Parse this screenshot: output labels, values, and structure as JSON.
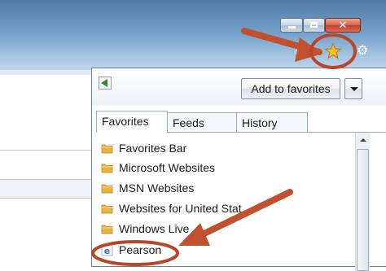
{
  "window": {
    "controls": {
      "minimize": "minimize",
      "maximize": "maximize",
      "close": "close"
    }
  },
  "toolbar": {
    "icons": [
      "home-icon",
      "favorites-star-icon",
      "tools-gear-icon"
    ]
  },
  "favorites_center": {
    "add_button_label": "Add to favorites",
    "tabs": [
      {
        "label": "Favorites",
        "selected": true
      },
      {
        "label": "Feeds",
        "selected": false
      },
      {
        "label": "History",
        "selected": false
      }
    ],
    "items": [
      {
        "label": "Favorites Bar",
        "icon": "folder-icon"
      },
      {
        "label": "Microsoft Websites",
        "icon": "folder-icon"
      },
      {
        "label": "MSN Websites",
        "icon": "folder-icon"
      },
      {
        "label": "Websites for United Stat",
        "icon": "folder-icon"
      },
      {
        "label": "Windows Live",
        "icon": "folder-icon"
      },
      {
        "label": "Pearson",
        "icon": "ie-page-icon"
      }
    ]
  },
  "annotations": {
    "color": "#c0502e",
    "targets": [
      "favorites-star-icon",
      "Pearson"
    ]
  }
}
